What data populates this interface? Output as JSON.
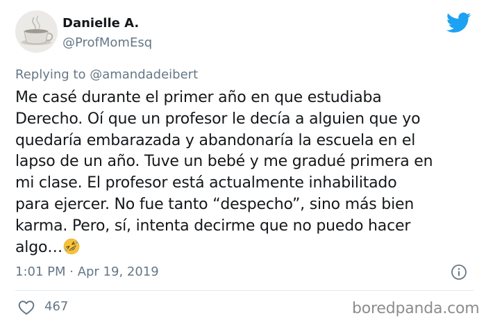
{
  "author": {
    "name": "Danielle A.",
    "handle": "@ProfMomEsq"
  },
  "reply": {
    "prefix": "Replying to ",
    "mention": "@amandadeibert"
  },
  "tweet": {
    "lines": [
      "Me casé durante el primer año en que estudiaba",
      "Derecho. Oí que un profesor le decía a alguien que yo",
      "quedaría embarazada y abandonaría la escuela en el",
      "lapso de un año. Tuve un bebé y me gradué primera en",
      "mi clase. El profesor está actualmente inhabilitado",
      "para ejercer. No fue tanto “despecho”, sino más bien",
      "karma. Pero, sí, intenta decirme que no puedo hacer",
      "algo…"
    ],
    "emoji": "rolling-on-the-floor-laughing-icon"
  },
  "meta": {
    "timestamp": "1:01 PM · Apr 19, 2019"
  },
  "engagement": {
    "likes": "467"
  },
  "watermark": "boredpanda.com",
  "colors": {
    "twitter_blue": "#1da1f2",
    "text": "#14171a",
    "secondary": "#657786",
    "divider": "#e1e8ed",
    "emoji_yellow": "#f7c23b"
  }
}
